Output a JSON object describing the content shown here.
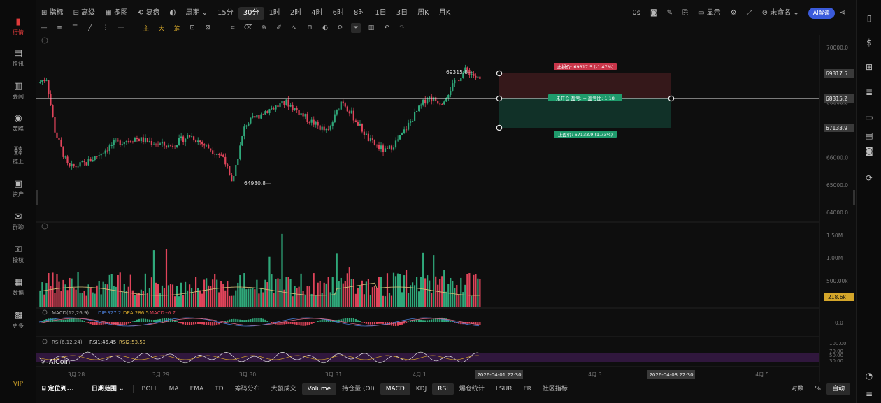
{
  "left_nav": [
    {
      "label": "行情",
      "icon": "bar-chart-icon",
      "active": true
    },
    {
      "label": "快讯",
      "icon": "news-icon"
    },
    {
      "label": "要闻",
      "icon": "article-icon"
    },
    {
      "label": "策略",
      "icon": "strategy-icon"
    },
    {
      "label": "链上",
      "icon": "chain-icon"
    },
    {
      "label": "资产",
      "icon": "wallet-icon"
    },
    {
      "label": "群聊",
      "icon": "chat-icon"
    },
    {
      "label": "授权",
      "icon": "key-icon"
    },
    {
      "label": "数据",
      "icon": "data-icon"
    },
    {
      "label": "更多",
      "icon": "grid-icon"
    }
  ],
  "vip_label": "VIP",
  "top_toolbar": {
    "indicator": "指标",
    "advanced": "高级",
    "multi_chart": "多图",
    "replay": "复盘",
    "period": "周期",
    "timeframes": [
      "15分",
      "30分",
      "1时",
      "2时",
      "4时",
      "6时",
      "8时",
      "1日",
      "3日",
      "周K",
      "月K"
    ],
    "active_timeframe": "30分",
    "zero_s": "0s",
    "display": "显示",
    "unnamed": "未命名",
    "ai_button": "AI解读"
  },
  "tool_chars": {
    "main": "主",
    "big": "大",
    "chip": "筹"
  },
  "price_axis": [
    "70000.0",
    "69000.0",
    "68000.0",
    "67000.0",
    "66000.0",
    "65000.0",
    "64000.0"
  ],
  "price_tags": {
    "stop_loss": "69317.5",
    "current": "68315.2",
    "take_profit": "67133.9"
  },
  "chart_annotations": {
    "high": "69315.8",
    "low": "64930.8",
    "stop_loss_label": "止损价: 69317.5 (-1.47%)",
    "position_label": "未开仓  盈亏: --  盈亏比: 1.18",
    "take_profit_label": "止盈价: 67133.9 (1.73%)"
  },
  "volume_axis": [
    "1.50M",
    "1.00M",
    "500.00k"
  ],
  "volume_tag": "218.6k",
  "macd": {
    "label": "MACD(12,26,9)",
    "dif": "DIF:327.2",
    "dea": "DEA:286.5",
    "macd_val": "MACD:-6.7",
    "axis": "0.0"
  },
  "rsi": {
    "label": "RSI(6,12,24)",
    "rsi1": "RSI1:45.45",
    "rsi2": "RSI2:53.59",
    "axis": [
      "100.00",
      "70.00",
      "50.00",
      "30.00"
    ]
  },
  "brand": "AiCoin",
  "date_axis": [
    "3月 28",
    "3月 29",
    "3月 30",
    "3月 31",
    "4月 1",
    "4月 3",
    "4月 5"
  ],
  "date_tags": [
    "2026-04-01 22:30",
    "2026-04-03 22:30"
  ],
  "bottom_bar": {
    "locate": "定位到...",
    "date_range": "日期范围",
    "items": [
      "BOLL",
      "MA",
      "EMA",
      "TD",
      "筹码分布",
      "大额成交",
      "Volume",
      "持仓量 (OI)",
      "MACD",
      "KDJ",
      "RSI",
      "爆仓统计",
      "LSUR",
      "FR",
      "社区指标"
    ],
    "active_items": [
      "Volume",
      "MACD",
      "RSI"
    ],
    "log": "对数",
    "percent": "%",
    "auto": "自动"
  },
  "chart_data": {
    "type": "candlestick",
    "x_labels": [
      "3月 28",
      "3月 29",
      "3月 30",
      "3月 31",
      "4月 1",
      "4月 3",
      "4月 5"
    ],
    "ylim": [
      63800,
      70200
    ],
    "series_summary": {
      "high": 69315.8,
      "low": 64930.8,
      "current": 68315.2,
      "stop_loss": 69317.5,
      "take_profit": 67133.9,
      "risk_reward": 1.18
    },
    "volume_last": "218.6k",
    "rsi": {
      "rsi1": 45.45,
      "rsi2": 53.59
    },
    "macd": {
      "dif": 327.2,
      "dea": 286.5,
      "macd": -6.7
    }
  },
  "colors": {
    "up": "#2fa87a",
    "down": "#e0445a",
    "accent": "#3b5bdb",
    "gold": "#d4a62a",
    "rsi_band": "#5a2a6e"
  }
}
